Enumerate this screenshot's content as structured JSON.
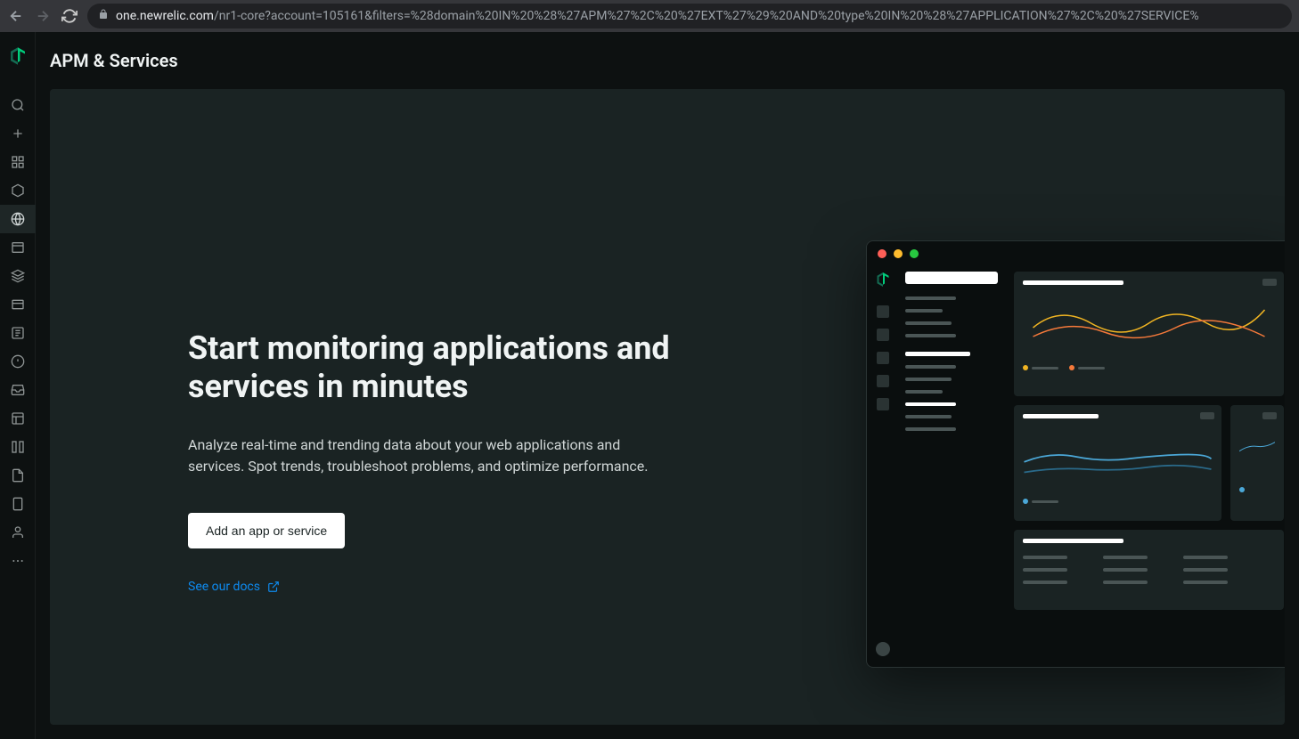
{
  "browser": {
    "url_domain": "one.newrelic.com",
    "url_path": "/nr1-core?account=105161&filters=%28domain%20IN%20%28%27APM%27%2C%20%27EXT%27%29%20AND%20type%20IN%20%28%27APPLICATION%27%2C%20%27SERVICE%"
  },
  "page": {
    "title": "APM & Services"
  },
  "hero": {
    "title": "Start monitoring applications and services in minutes",
    "description": "Analyze real-time and trending data about your web applications and services. Spot trends, troubleshoot problems, and optimize performance.",
    "cta_label": "Add an app or service",
    "docs_link": "See our docs"
  },
  "colors": {
    "accent_green": "#00ce7c",
    "link_blue": "#0e8bf0",
    "chart_yellow": "#f0b422",
    "chart_orange": "#f5793a",
    "chart_blue": "#4ba8d8"
  }
}
